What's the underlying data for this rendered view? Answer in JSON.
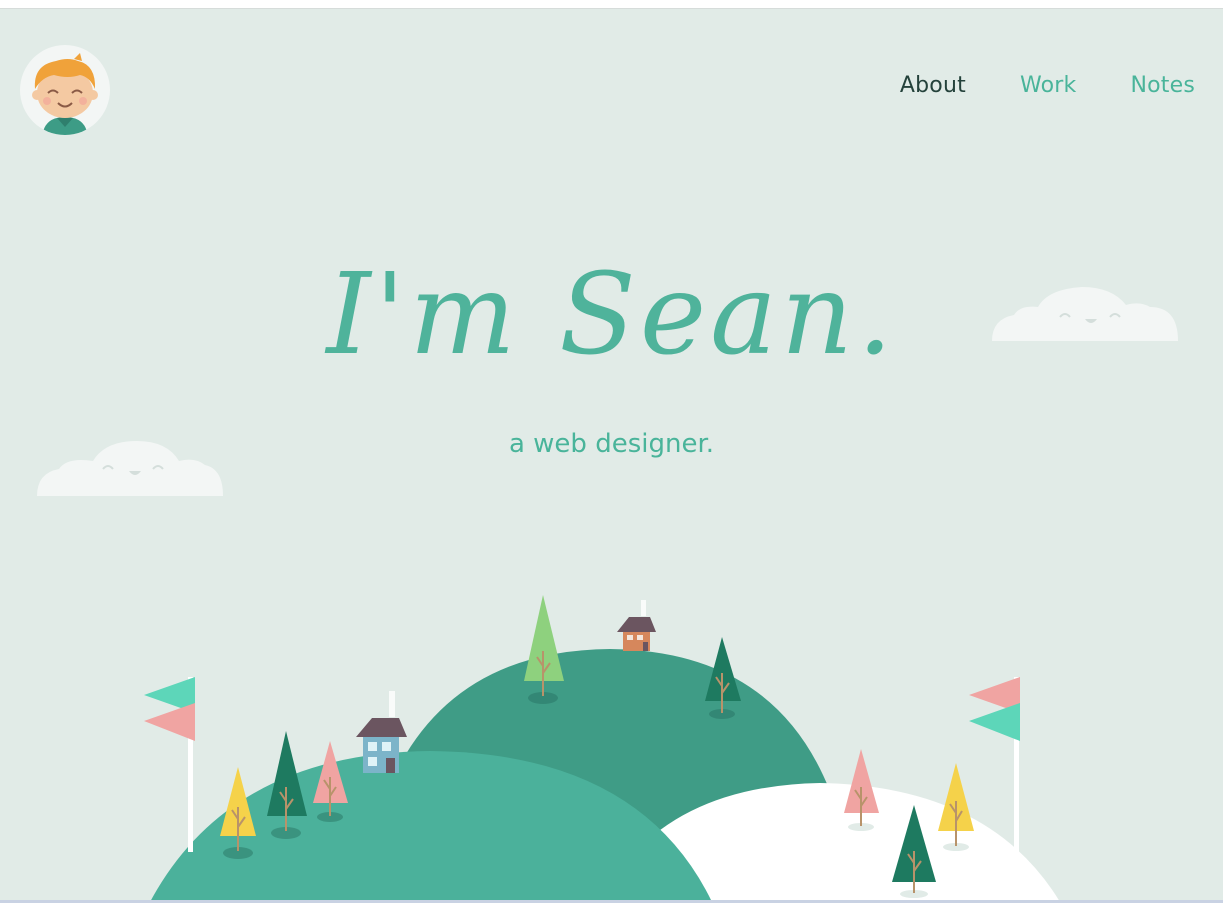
{
  "nav": {
    "items": [
      {
        "label": "About",
        "active": true
      },
      {
        "label": "Work",
        "active": false
      },
      {
        "label": "Notes",
        "active": false
      }
    ]
  },
  "hero": {
    "title": "I'm Sean.",
    "subtitle": "a web designer."
  },
  "colors": {
    "background": "#e1ebe7",
    "accent": "#4fb39b",
    "nav_active": "#24423b",
    "hill_dark": "#3f9c86",
    "hill_mid": "#4bb19b",
    "snow": "#ffffff"
  },
  "icons": [
    "avatar-boy",
    "smiling-cloud",
    "flag",
    "tree",
    "house"
  ]
}
